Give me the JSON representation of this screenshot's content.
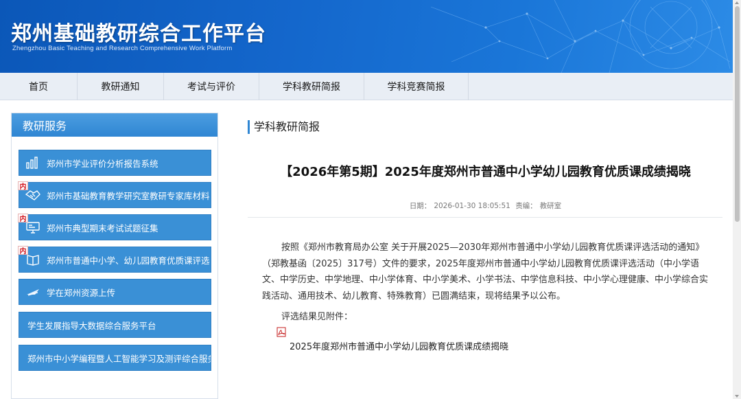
{
  "banner": {
    "title": "郑州基础教研综合工作平台",
    "subtitle": "Zhengzhou Basic Teaching and Research Comprehensive Work Platform"
  },
  "nav": {
    "items": [
      {
        "label": "首页"
      },
      {
        "label": "教研通知"
      },
      {
        "label": "考试与评价"
      },
      {
        "label": "学科教研简报"
      },
      {
        "label": "学科竞赛简报"
      }
    ]
  },
  "sidebar": {
    "header": "教研服务",
    "tag_label": "内",
    "items": [
      {
        "label": "郑州市学业评价分析报告系统",
        "icon": "bar-chart-icon"
      },
      {
        "label": "郑州市基础教育教学研究室教研专家库材料",
        "icon": "handshake-icon",
        "tagged": true
      },
      {
        "label": "郑州市典型期末考试试题征集",
        "icon": "monitor-icon",
        "tagged": true
      },
      {
        "label": "郑州市普通中小学、幼儿园教育优质课评选",
        "icon": "book-icon",
        "tagged": true
      },
      {
        "label": "学在郑州资源上传",
        "icon": "upload-logo-icon"
      },
      {
        "label": "学生发展指导大数据综合服务平台"
      },
      {
        "label": "郑州市中小学编程暨人工智能学习及测评综合服务"
      }
    ]
  },
  "main": {
    "section_title": "学科教研简报",
    "article_title": "【2026年第5期】2025年度郑州市普通中小学幼儿园教育优质课成绩揭晓",
    "meta": {
      "date_label": "日期：",
      "date": "2026-01-30 18:05:51",
      "editor_label": "责编：",
      "editor": "教研室"
    },
    "paragraph": "按照《郑州市教育局办公室 关于开展2025—2030年郑州市普通中小学幼儿园教育优质课评选活动的通知》（郑教基函〔2025〕317号）文件的要求，2025年度郑州市普通中小学幼儿园教育优质课评选活动（中小学语文、中学历史、中学地理、中小学体育、中小学美术、小学书法、中学信息科技、中小学心理健康、中小学综合实践活动、通用技术、幼儿教育、特殊教育）已圆满结束，现将结果予以公布。",
    "attachment_label": "评选结果见附件：",
    "attachment_name": "2025年度郑州市普通中小学幼儿园教育优质课成绩揭晓",
    "attachment_icon": "pdf-icon"
  },
  "colors": {
    "banner": "#1467cc",
    "nav_bg": "#e9eef5",
    "sidebar_button": "#3a90d6",
    "accent": "#2f86d3",
    "tag": "#d2121b"
  }
}
